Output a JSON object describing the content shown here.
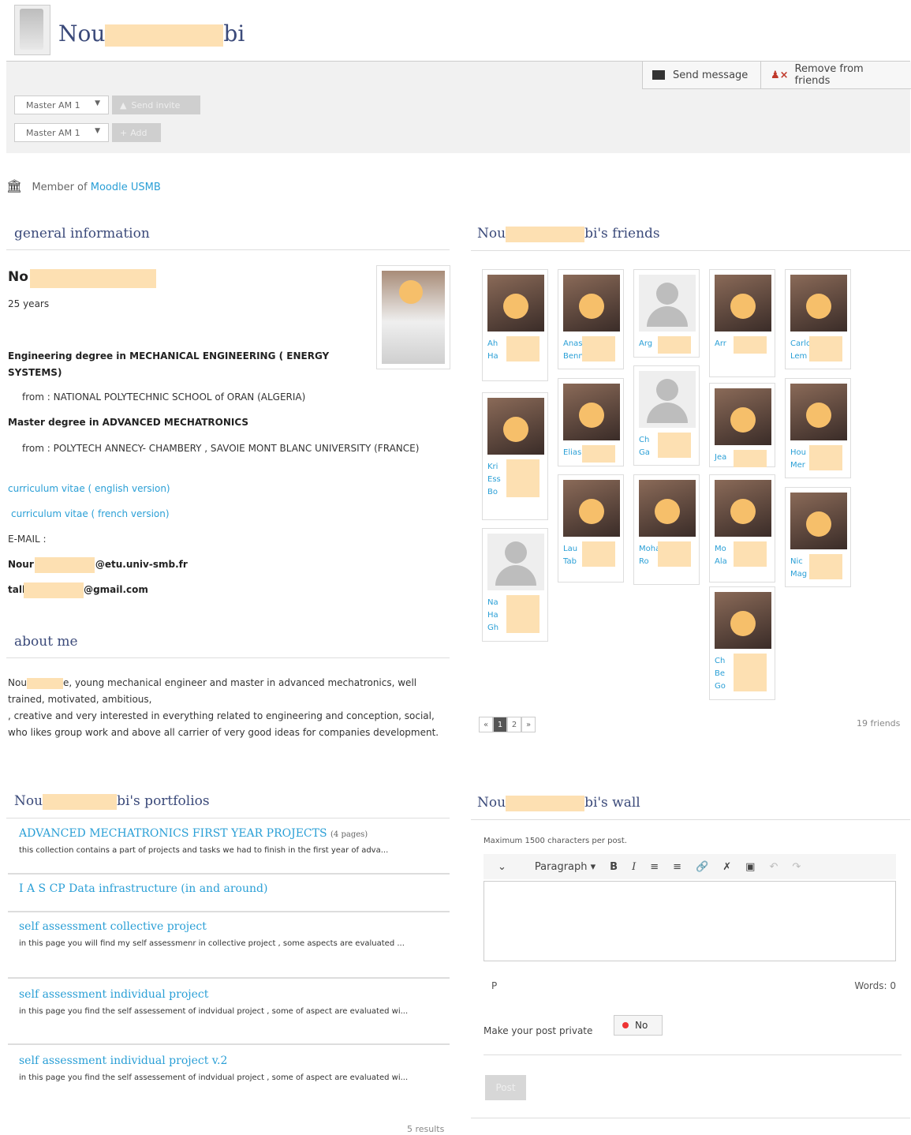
{
  "header": {
    "title_start": "Nou",
    "title_end": "bi",
    "send_message": "Send message",
    "remove_friends": "Remove from friends",
    "select1": "Master AM 1",
    "send_invite": "Send invite",
    "select2": "Master AM 1",
    "add": "Add"
  },
  "member": {
    "prefix": "Member of",
    "group": "Moodle USMB"
  },
  "general": {
    "heading": "general information",
    "name": "No",
    "age": "25 years",
    "degree1": "Engineering degree in MECHANICAL ENGINEERING ( ENERGY SYSTEMS)",
    "from1": "from : NATIONAL POLYTECHNIC SCHOOL of ORAN (ALGERIA)",
    "degree2": "Master degree in ADVANCED MECHATRONICS",
    "from2": "from : POLYTECH ANNECY- CHAMBERY , SAVOIE MONT BLANC UNIVERSITY (FRANCE)",
    "cv_en": "curriculum vitae ( english version)",
    "cv_fr": "curriculum vitae ( french version)",
    "email_label": "E-MAIL :",
    "email1_start": "Nour",
    "email1_end": "i@etu.univ-smb.fr",
    "email2_start": "tall",
    "email2_end": "@gmail.com"
  },
  "about": {
    "heading": "about me",
    "text_start": "Nou",
    "text_rest": "e, young mechanical engineer and master in advanced mechatronics, well trained, motivated, ambitious,",
    "text2": ", creative and very interested in everything related to engineering and conception, social, who likes group work and above all carrier of very good ideas for companies development."
  },
  "friends": {
    "heading_start": "Nou",
    "heading_end": "bi's friends",
    "count": "19 friends",
    "pages": [
      "«",
      "1",
      "2",
      "»"
    ],
    "names": [
      {
        "lines": [
          "Ah",
          "Ha"
        ]
      },
      {
        "lines": [
          "Anas",
          "Bennouk"
        ]
      },
      {
        "lines": [
          "Arg"
        ]
      },
      {
        "lines": [
          "Arr"
        ]
      },
      {
        "lines": [
          "Carlos Perez",
          "Lem"
        ]
      },
      {
        "lines": [
          "Kri",
          "Ess",
          "Bo"
        ]
      },
      {
        "lines": [
          "Elias Sarkis"
        ]
      },
      {
        "lines": [
          "Ch",
          "Ga"
        ]
      },
      {
        "lines": [
          "Jea"
        ]
      },
      {
        "lines": [
          "Hou",
          "Mer"
        ]
      },
      {
        "lines": [
          "Lau",
          "Tab"
        ]
      },
      {
        "lines": [
          "Mohamed",
          "Ro"
        ]
      },
      {
        "lines": [
          "Mo",
          "Ala"
        ]
      },
      {
        "lines": [
          "Nic",
          "Mag"
        ]
      },
      {
        "lines": [
          "Na",
          "Ha",
          "Gh"
        ]
      },
      {
        "lines": [
          "Ch",
          "Be",
          "Go"
        ]
      }
    ]
  },
  "portfolios": {
    "heading_start": "Nou",
    "heading_end": "bi's portfolios",
    "items": [
      {
        "title": "ADVANCED MECHATRONICS FIRST YEAR PROJECTS",
        "pages": "(4 pages)",
        "desc": "this collection contains a part of projects and tasks we had to finish in the first year of adva..."
      },
      {
        "title": "I A S CP Data infrastructure (in and around)",
        "pages": "",
        "desc": ""
      },
      {
        "title": "self assessment collective project",
        "pages": "",
        "desc": "in this page you will find my self assessmenr in collective project , some aspects are evaluated ..."
      },
      {
        "title": "self assessment individual project",
        "pages": "",
        "desc": "in this page you find the self assessement of indvidual project , some of aspect are evaluated wi..."
      },
      {
        "title": "self assessment individual project v.2",
        "pages": "",
        "desc": "in this page you find the self assessement of indvidual project , some of aspect are evaluated wi..."
      }
    ],
    "results": "5 results"
  },
  "wall": {
    "heading_start": "Nou",
    "heading_end": "bi's wall",
    "note": "Maximum 1500 characters per post.",
    "format": "Paragraph",
    "status_left": "P",
    "words": "Words: 0",
    "private_label": "Make your post private",
    "toggle": "No",
    "post": "Post"
  }
}
